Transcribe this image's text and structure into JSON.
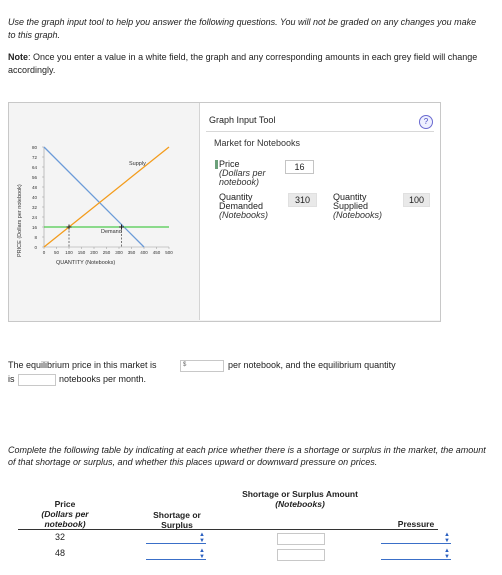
{
  "instructions": {
    "intro": "Use the graph input tool to help you answer the following questions. You will not be graded on any changes you make to this graph.",
    "note_label": "Note",
    "note_text": ": Once you enter a value in a white field, the graph and any corresponding amounts in each grey field will change accordingly."
  },
  "graph": {
    "y_axis_label": "PRICE (Dollars per notebook)",
    "x_axis_label": "QUANTITY (Notebooks)",
    "y_ticks": [
      "80",
      "72",
      "64",
      "56",
      "48",
      "40",
      "32",
      "24",
      "16",
      "8",
      "0"
    ],
    "x_ticks": [
      "0",
      "50",
      "100",
      "150",
      "200",
      "250",
      "300",
      "350",
      "400",
      "450",
      "500"
    ],
    "supply_label": "Supply",
    "demand_label": "Demand",
    "colors": {
      "supply": "#f39c1c",
      "demand": "#6b9bd8",
      "price_line": "#4cc94c",
      "marker": "#222222"
    }
  },
  "graph_input_tool": {
    "title": "Graph Input Tool",
    "help_icon": "?",
    "market_title": "Market for Notebooks",
    "price_label": "Price",
    "price_unit": "(Dollars per notebook)",
    "price_value": "16",
    "qd_label": "Quantity Demanded",
    "qd_unit": "(Notebooks)",
    "qd_value": "310",
    "qs_label": "Quantity Supplied",
    "qs_unit": "(Notebooks)",
    "qs_value": "100"
  },
  "equilibrium": {
    "part1": "The equilibrium price in this market is",
    "dollar": "$",
    "part2": "per notebook, and the equilibrium quantity",
    "part3": "is",
    "part4": "notebooks per month."
  },
  "table_instructions": "Complete the following table by indicating at each price whether there is a shortage or surplus in the market, the amount of that shortage or surplus, and whether this places upward or downward pressure on prices.",
  "table": {
    "col_price": "Price",
    "col_price_unit": "(Dollars per notebook)",
    "col_shortage": "Shortage or Surplus",
    "col_amount": "Shortage or Surplus Amount",
    "col_amount_unit": "(Notebooks)",
    "col_pressure": "Pressure",
    "rows": [
      {
        "price": "32"
      },
      {
        "price": "48"
      }
    ]
  }
}
